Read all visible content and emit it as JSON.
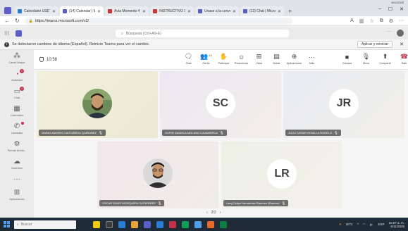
{
  "os": {
    "top_clock": "6/11/2025"
  },
  "browser": {
    "tabs": [
      {
        "label": "Calendario USETT RC",
        "color": "#2b7cd3",
        "active": false
      },
      {
        "label": "(14) Calendar | Mi",
        "color": "#5b5fc7",
        "active": true
      },
      {
        "label": "Acta Momento 4 y 5",
        "color": "#d13438",
        "active": false
      },
      {
        "label": "INSTRUCTIVO SOLIFI",
        "color": "#d13438",
        "active": false
      },
      {
        "label": "Únase a la conversaci",
        "color": "#5b5fc7",
        "active": false
      },
      {
        "label": "(12) Chat | Microsoft T",
        "color": "#5b5fc7",
        "active": false
      }
    ],
    "url": "https://teams.microsoft.com/v2/",
    "controls": {
      "minimize": "–",
      "maximize": "☐",
      "close": "✕"
    }
  },
  "teams_header": {
    "search_placeholder": "Búsqueda (Ctrl+Alt+E)",
    "more": "···"
  },
  "notification": {
    "text": "Se detectaron cambios de idioma (Español). Reinicie Teams para ver el cambio.",
    "button": "Aplicar y reiniciar",
    "close": "✕"
  },
  "rail": {
    "items": [
      {
        "label": "Canal Unique",
        "icon": "waffle-icon",
        "glyph": "⁂",
        "badge": ""
      },
      {
        "label": "Actividad",
        "icon": "bell-icon",
        "glyph": "🔔",
        "badge": "1"
      },
      {
        "label": "Chat",
        "icon": "chat-icon",
        "glyph": "💬",
        "badge": "1"
      },
      {
        "label": "Calendario",
        "icon": "calendar-icon",
        "glyph": "▦",
        "badge": ""
      },
      {
        "label": "Llamadas",
        "icon": "phone-icon",
        "glyph": "✆",
        "badge": "●"
      },
      {
        "label": "Prende Archiv...",
        "icon": "files-icon",
        "glyph": "⚙",
        "badge": ""
      },
      {
        "label": "OneDrive",
        "icon": "cloud-icon",
        "glyph": "☁",
        "badge": ""
      },
      {
        "label": "",
        "icon": "more-icon",
        "glyph": "···",
        "badge": ""
      },
      {
        "label": "Aplicaciones",
        "icon": "apps-icon",
        "glyph": "⊞",
        "badge": ""
      }
    ]
  },
  "meeting": {
    "timer": "10:58",
    "participants_count": "14",
    "tools": [
      {
        "label": "Chat",
        "icon": "chat-icon",
        "glyph": "🗨"
      },
      {
        "label": "Gente",
        "icon": "people-icon",
        "glyph": "👥"
      },
      {
        "label": "Participar",
        "icon": "raise-hand-icon",
        "glyph": "✋"
      },
      {
        "label": "Reaccionar",
        "icon": "react-icon",
        "glyph": "☺"
      },
      {
        "label": "Vista",
        "icon": "view-icon",
        "glyph": "⊞"
      },
      {
        "label": "Notas",
        "icon": "notes-icon",
        "glyph": "▤"
      },
      {
        "label": "Aplicaciones",
        "icon": "apps-icon",
        "glyph": "⊕"
      },
      {
        "label": "Más",
        "icon": "more-icon",
        "glyph": "···"
      }
    ],
    "tools_right": [
      {
        "label": "Cámara",
        "icon": "camera-icon",
        "glyph": "■"
      },
      {
        "label": "Micro",
        "icon": "mic-icon",
        "glyph": "🎙"
      },
      {
        "label": "Compartir",
        "icon": "share-icon",
        "glyph": "⬆"
      },
      {
        "label": "Salir",
        "icon": "leave-icon",
        "glyph": "☎"
      }
    ],
    "participants": [
      {
        "name": "MARIO ANDRES CASTAÑEDA QUIÑONEZ",
        "initials": "",
        "photo": true
      },
      {
        "name": "SORIN DANIELA MOLANO CAJAMARCA",
        "initials": "SC",
        "photo": false
      },
      {
        "name": "JULIO CESAR BONILLA RODELO",
        "initials": "JR",
        "photo": false
      },
      {
        "name": "OSCAR DAVID MOSQUERA GUTIERREZ",
        "initials": "",
        "photo": true
      },
      {
        "name": "Larry Felipe Hernández Ramírez (Externo)",
        "initials": "LR",
        "photo": false
      }
    ],
    "pager": {
      "prev": "‹",
      "page": "2/2",
      "next": "›"
    }
  },
  "taskbar": {
    "search_placeholder": "Buscar",
    "weather": "30°C",
    "lang": "ESP",
    "time": "10:07 a. m.",
    "date": "6/11/2025"
  }
}
